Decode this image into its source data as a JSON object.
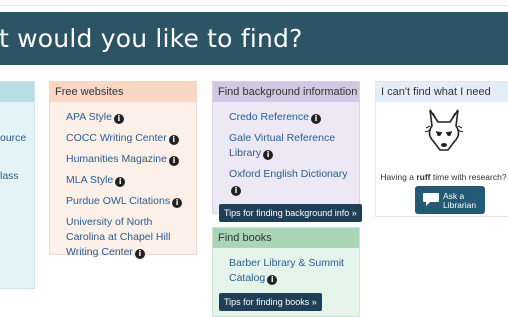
{
  "banner": {
    "title": "t would you like to find?"
  },
  "left_panel": {
    "fragments": [
      "ource",
      "lass"
    ]
  },
  "free_websites": {
    "title": "Free websites",
    "links": [
      "APA Style",
      "COCC Writing Center",
      "Humanities Magazine",
      "MLA Style",
      "Purdue OWL Citations",
      "University of North Carolina at Chapel Hill Writing Center"
    ],
    "info_glyph": "i"
  },
  "background_info": {
    "title": "Find background information",
    "links": [
      "Credo Reference",
      "Gale Virtual Reference Library",
      "Oxford English Dictionary"
    ],
    "tips_button": "Tips for finding background info »"
  },
  "find_books": {
    "title": "Find books",
    "links": [
      "Barber Library & Summit Catalog"
    ],
    "tips_button": "Tips for finding books »"
  },
  "cant_find": {
    "title": "I can't find what I need",
    "tagline_prefix": "Having a ",
    "tagline_bold": "ruff",
    "tagline_suffix": " time with research?",
    "ask_button_line1": "Ask a",
    "ask_button_line2": "Librarian"
  }
}
